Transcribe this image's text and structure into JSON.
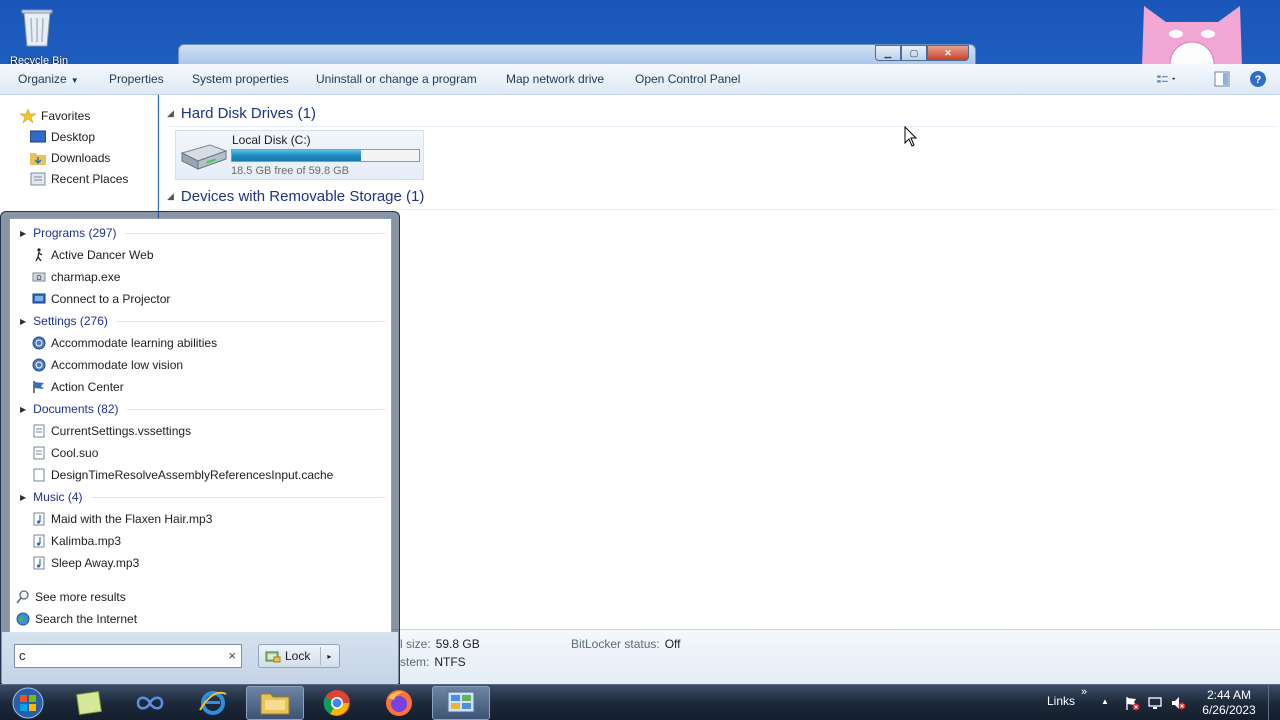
{
  "desktop": {
    "recycle_bin_label": "Recycle Bin"
  },
  "explorer": {
    "window_buttons": {
      "minimize": "▁",
      "maximize": "▢",
      "close": "✕"
    },
    "toolbar": {
      "organize": "Organize",
      "properties": "Properties",
      "system_properties": "System properties",
      "uninstall": "Uninstall or change a program",
      "map_drive": "Map network drive",
      "control_panel": "Open Control Panel"
    },
    "nav": {
      "favorites": "Favorites",
      "desktop": "Desktop",
      "downloads": "Downloads",
      "recent": "Recent Places"
    },
    "groups": {
      "hard_disks": "Hard Disk Drives (1)",
      "removable": "Devices with Removable Storage (1)"
    },
    "drive": {
      "name": "Local Disk (C:)",
      "free_text": "18.5 GB free of 59.8 GB",
      "used_fraction": 0.69
    },
    "details": {
      "size_label": "l size:",
      "size_value": "59.8 GB",
      "fs_label": "stem:",
      "fs_value": "NTFS",
      "bitlocker_label": "BitLocker status:",
      "bitlocker_value": "Off"
    }
  },
  "start_menu": {
    "categories": {
      "programs": "Programs (297)",
      "settings": "Settings (276)",
      "documents": "Documents (82)",
      "music": "Music (4)"
    },
    "programs": [
      "Active Dancer Web",
      "charmap.exe",
      "Connect to a Projector"
    ],
    "settings": [
      "Accommodate learning abilities",
      "Accommodate low vision",
      "Action Center"
    ],
    "documents": [
      "CurrentSettings.vssettings",
      "Cool.suo",
      "DesignTimeResolveAssemblyReferencesInput.cache"
    ],
    "music": [
      "Maid with the Flaxen Hair.mp3",
      "Kalimba.mp3",
      "Sleep Away.mp3"
    ],
    "see_more": "See more results",
    "search_internet": "Search the Internet",
    "search_value": "c",
    "clear": "×",
    "lock": "Lock",
    "lock_arrow": "▸"
  },
  "taskbar": {
    "links": "Links",
    "chevron": "»",
    "tray_up": "▲",
    "time": "2:44 AM",
    "date": "6/26/2023"
  },
  "colors": {
    "accent_blue": "#1e3287",
    "drive_fill": "#1f8bc0"
  }
}
